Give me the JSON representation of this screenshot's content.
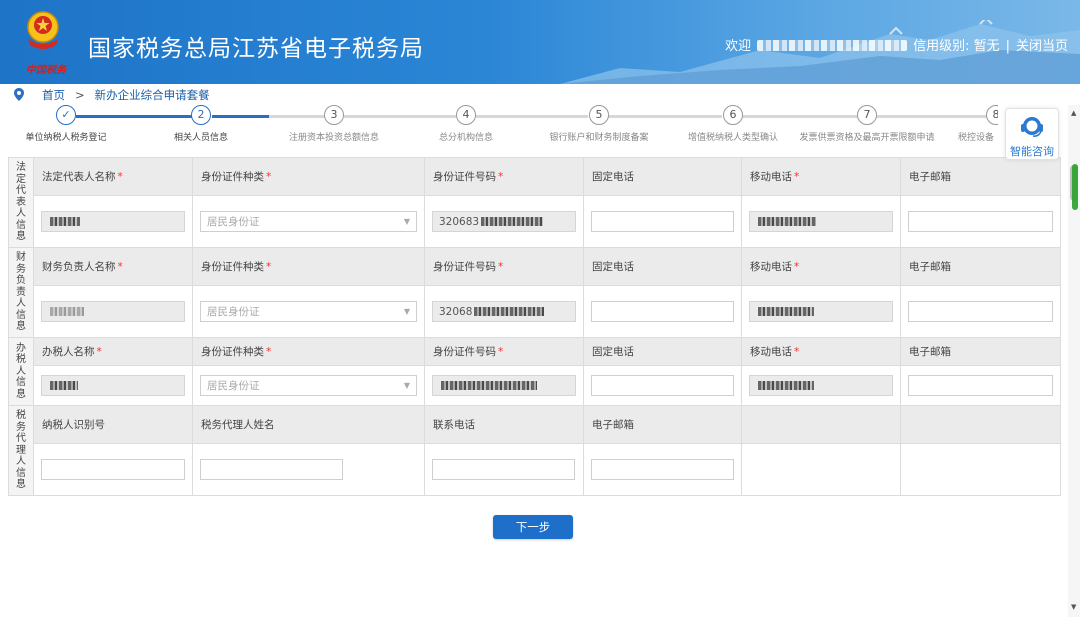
{
  "header": {
    "site_title": "国家税务总局江苏省电子税务局",
    "motto": "中国税务",
    "welcome": "欢迎",
    "credit_label": "信用级别: 暂无",
    "close_label": "关闭当页"
  },
  "breadcrumb": {
    "home": "首页",
    "separator": ">",
    "current": "新办企业综合申请套餐"
  },
  "steps": [
    {
      "num": "✓",
      "label": "单位纳税人税务登记"
    },
    {
      "num": "2",
      "label": "相关人员信息"
    },
    {
      "num": "3",
      "label": "注册资本投资总额信息"
    },
    {
      "num": "4",
      "label": "总分机构信息"
    },
    {
      "num": "5",
      "label": "银行账户和财务制度备案"
    },
    {
      "num": "6",
      "label": "增值税纳税人类型确认"
    },
    {
      "num": "7",
      "label": "发票供票资格及最高开票限额申请"
    },
    {
      "num": "8",
      "label": "税控设备"
    }
  ],
  "sections": {
    "legal": {
      "title": "法定代表人信息",
      "col1": "法定代表人名称",
      "col2": "身份证件种类",
      "col3": "身份证件号码",
      "col4": "固定电话",
      "col5": "移动电话",
      "col6": "电子邮箱",
      "id_type": "居民身份证",
      "id_prefix": "320683"
    },
    "finance": {
      "title": "财务负责人信息",
      "col1": "财务负责人名称",
      "col2": "身份证件种类",
      "col3": "身份证件号码",
      "col4": "固定电话",
      "col5": "移动电话",
      "col6": "电子邮箱",
      "id_type": "居民身份证",
      "id_prefix": "32068"
    },
    "taxer": {
      "title": "办税人信息",
      "col1": "办税人名称",
      "col2": "身份证件种类",
      "col3": "身份证件号码",
      "col4": "固定电话",
      "col5": "移动电话",
      "col6": "电子邮箱",
      "id_type": "居民身份证",
      "id_prefix": ""
    },
    "agent": {
      "title": "税务代理人信息",
      "col1": "纳税人识别号",
      "col2": "税务代理人姓名",
      "col3": "联系电话",
      "col4": "电子邮箱"
    }
  },
  "required_mark": "*",
  "next_button": "下一步",
  "consult_label": "智能咨询",
  "colors": {
    "primary": "#1d6fc9",
    "header": "#2b86d6",
    "required": "#ee3333"
  }
}
